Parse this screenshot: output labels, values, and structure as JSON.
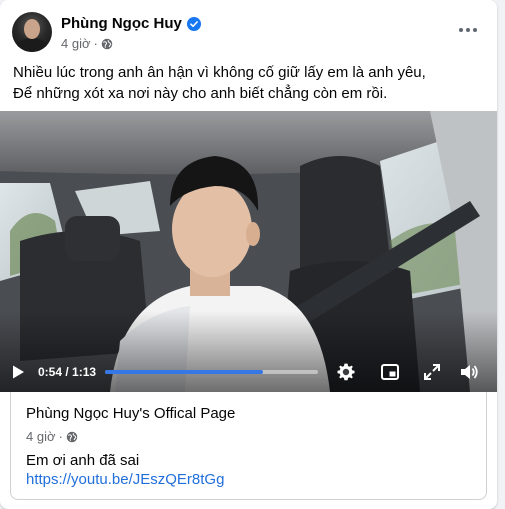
{
  "post": {
    "author": "Phùng Ngọc Huy",
    "time": "4 giờ",
    "dot": "·",
    "text_lines": [
      "Nhiều lúc trong anh ân hận vì không cố giữ lấy em là anh yêu,",
      "Để những xót xa nơi này cho anh biết chẳng còn em rồi."
    ]
  },
  "video": {
    "time_display": "0:54 / 1:13",
    "progress": 0.74,
    "colors": {
      "progress_fill": "#3578e5"
    }
  },
  "link_preview": {
    "title": "Phùng Ngọc Huy's Offical Page",
    "time": "4 giờ",
    "dot": "·",
    "text": "Em ơi anh đã sai",
    "url": "https://youtu.be/JEszQEr8tGg"
  },
  "icons": {
    "verified": "verified-badge-icon",
    "privacy": "globe-icon",
    "more": "more-options-icon",
    "play": "play-icon",
    "settings": "gear-icon",
    "pip": "picture-in-picture-icon",
    "fullscreen": "fullscreen-icon",
    "volume": "volume-icon"
  }
}
